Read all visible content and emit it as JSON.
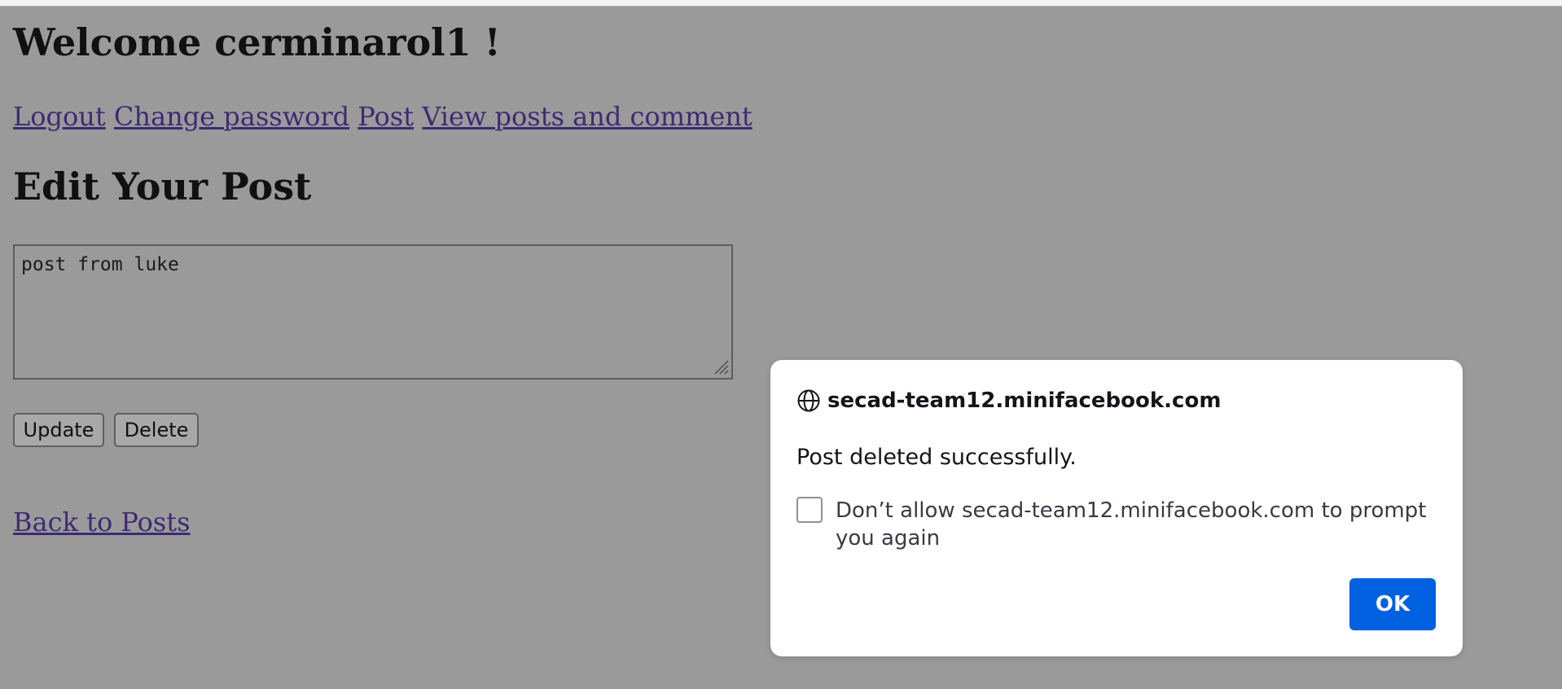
{
  "page": {
    "welcome": "Welcome cerminarol1 !",
    "nav": {
      "logout": "Logout",
      "change_password": "Change password",
      "post": "Post",
      "view_posts": "View posts and comment"
    },
    "heading": "Edit Your Post",
    "post_content": "post from luke",
    "update_label": "Update",
    "delete_label": "Delete",
    "back_label": "Back to Posts"
  },
  "dialog": {
    "origin": "secad-team12.minifacebook.com",
    "message": "Post deleted successfully.",
    "checkbox_label": "Don’t allow secad-team12.minifacebook.com to prompt you again",
    "checkbox_checked": false,
    "ok_label": "OK",
    "origin_icon": "globe-icon",
    "accent_color": "#0061e0"
  }
}
